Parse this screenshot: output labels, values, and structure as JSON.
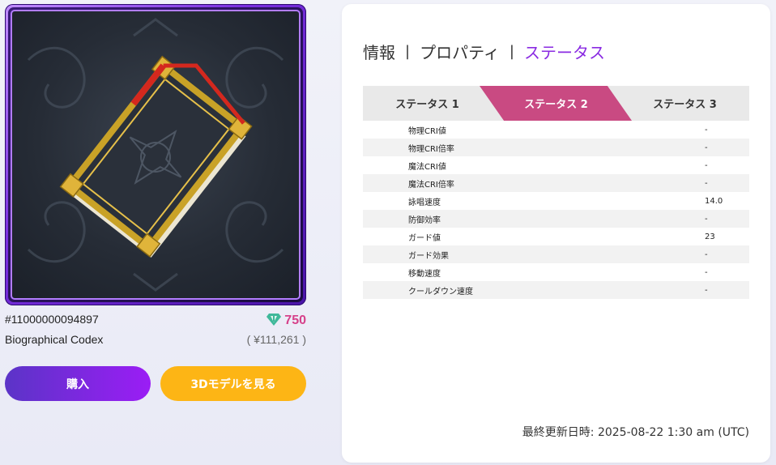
{
  "item": {
    "id": "#11000000094897",
    "name": "Biographical Codex",
    "price": "750",
    "price_jpy": "( ¥111,261 )",
    "currency_icon": "gem-icon",
    "currency_color": "#3fb89a",
    "price_color": "#d6408a"
  },
  "buttons": {
    "buy": "購入",
    "view_3d": "3Dモデルを見る"
  },
  "tabs": [
    {
      "label": "情報"
    },
    {
      "label": "プロパティ"
    },
    {
      "label": "ステータス"
    }
  ],
  "tab_separator": "|",
  "stat_tabs": [
    {
      "label": "ステータス 1"
    },
    {
      "label": "ステータス 2"
    },
    {
      "label": "ステータス 3"
    }
  ],
  "stats": [
    {
      "label": "物理CRI値",
      "value": "-"
    },
    {
      "label": "物理CRI倍率",
      "value": "-"
    },
    {
      "label": "魔法CRI値",
      "value": "-"
    },
    {
      "label": "魔法CRI倍率",
      "value": "-"
    },
    {
      "label": "詠唱速度",
      "value": "14.0"
    },
    {
      "label": "防御効率",
      "value": "-"
    },
    {
      "label": "ガード値",
      "value": "23"
    },
    {
      "label": "ガード効果",
      "value": "-"
    },
    {
      "label": "移動速度",
      "value": "-"
    },
    {
      "label": "クールダウン速度",
      "value": "-"
    }
  ],
  "updated": "最終更新日時: 2025-08-22 1:30 am (UTC)",
  "colors": {
    "accent_purple": "#8a2be2",
    "active_stat_tab": "#c94a82",
    "buy_button": "#7b2bdd",
    "view_3d_button": "#fdb515"
  }
}
